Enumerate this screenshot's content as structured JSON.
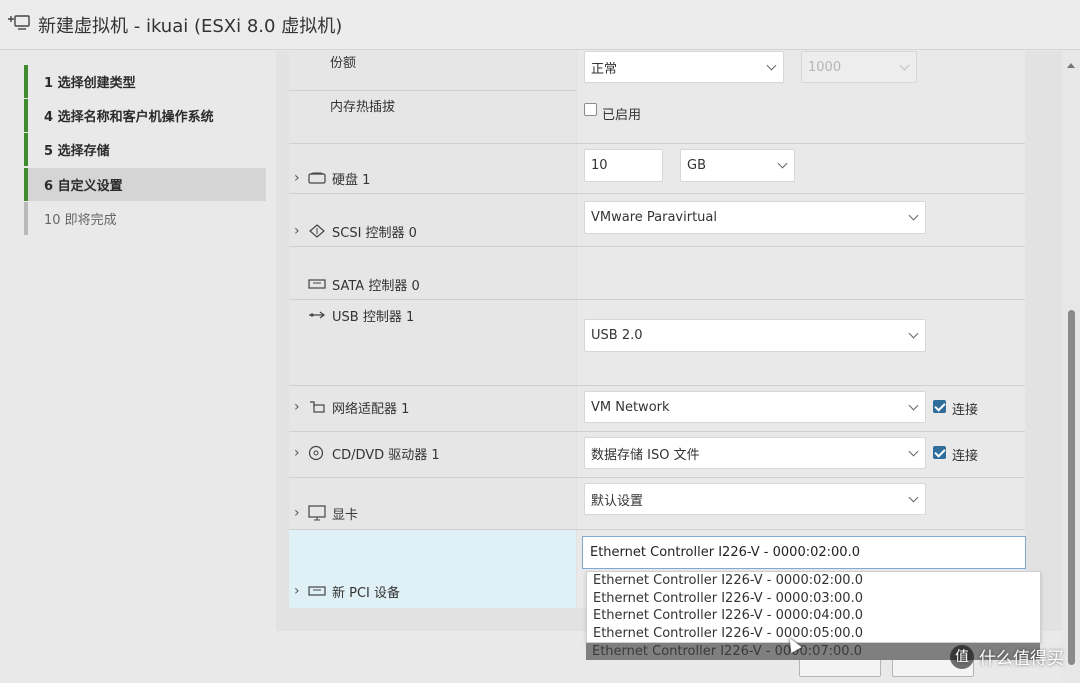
{
  "window": {
    "title": "新建虚拟机 - ikuai (ESXi 8.0 虚拟机)"
  },
  "sidebar": {
    "steps": [
      {
        "label": "1  选择创建类型",
        "state": "done"
      },
      {
        "label": "4  选择名称和客户机操作系统",
        "state": "done"
      },
      {
        "label": "5  选择存储",
        "state": "done"
      },
      {
        "label": "6  自定义设置",
        "state": "active"
      },
      {
        "label": "10  即将完成",
        "state": "pending"
      }
    ]
  },
  "memory": {
    "shares_label": "份额",
    "shares_value": "正常",
    "shares_number": "1000",
    "hotplug_label": "内存热插拔",
    "hotplug_checkbox": "已启用"
  },
  "disk": {
    "label": "硬盘 1",
    "size": "10",
    "unit": "GB"
  },
  "scsi": {
    "label": "SCSI 控制器 0",
    "value": "VMware Paravirtual"
  },
  "sata": {
    "label": "SATA 控制器 0"
  },
  "usb": {
    "label": "USB 控制器 1",
    "value": "USB 2.0"
  },
  "network": {
    "label": "网络适配器 1",
    "value": "VM Network",
    "connect_label": "连接"
  },
  "cdrom": {
    "label": "CD/DVD 驱动器 1",
    "value": "数据存储 ISO 文件",
    "connect_label": "连接"
  },
  "video": {
    "label": "显卡",
    "value": "默认设置"
  },
  "pci": {
    "label": "新 PCI 设备",
    "selected": "Ethernet Controller I226-V - 0000:02:00.0",
    "options": [
      "Ethernet Controller I226-V - 0000:02:00.0",
      "Ethernet Controller I226-V - 0000:03:00.0",
      "Ethernet Controller I226-V - 0000:04:00.0",
      "Ethernet Controller I226-V - 0000:05:00.0",
      "Ethernet Controller I226-V - 0000:07:00.0"
    ]
  },
  "watermark": {
    "logo": "值",
    "text": "什么值得买"
  },
  "colors": {
    "step_done": "#3f8b2e",
    "step_pending": "#b9b9b9",
    "pci_highlight": "#dff1f6",
    "checkbox_on": "#2f6e9a"
  }
}
